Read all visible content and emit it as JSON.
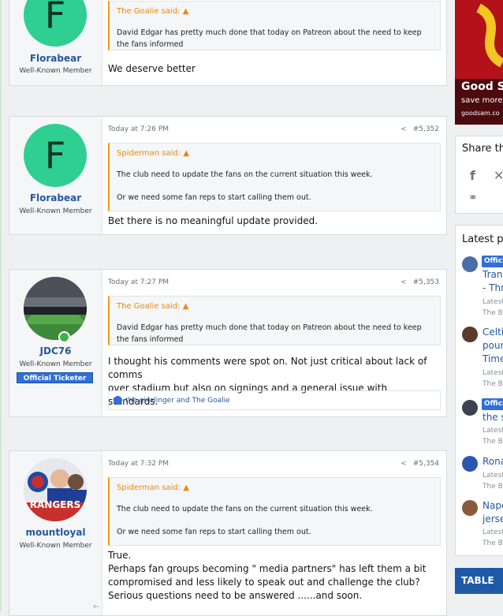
{
  "posts": [
    {
      "username": "Florabear",
      "user_title": "Well-Known Member",
      "avatar_letter": "F",
      "quote_author": "The Goalie said:",
      "quote_lines": [
        "David Edgar has pretty much done that today on Patreon about the need to keep",
        "the fans informed"
      ],
      "body_lines": [
        "We deserve better"
      ]
    },
    {
      "timestamp": "Today at 7:26 PM",
      "post_number": "#5,352",
      "username": "Florabear",
      "user_title": "Well-Known Member",
      "avatar_letter": "F",
      "quote_author": "Spiderman said:",
      "quote_lines": [
        "The club need to update the fans on the current situation this week.",
        "Or we need some fan reps to start calling them out."
      ],
      "body_lines": [
        "Bet there is no meaningful update provided."
      ]
    },
    {
      "timestamp": "Today at 7:27 PM",
      "post_number": "#5,353",
      "username": "JDC76",
      "user_title": "Well-Known Member",
      "user_badge": "Official Ticketer",
      "quote_author": "The Goalie said:",
      "quote_lines": [
        "David Edgar has pretty much done that today on Patreon about the need to keep",
        "the fans informed"
      ],
      "body_lines": [
        "I thought his comments were spot on. Not just critical about lack of comms",
        "over stadium but also on signings and a general issue with standards."
      ],
      "reactions": "the ginslinger and The Goalie"
    },
    {
      "timestamp": "Today at 7:32 PM",
      "post_number": "#5,354",
      "username": "mountloyal",
      "user_title": "Well-Known Member",
      "avatar_text": "RANGERS",
      "quote_author": "Spiderman said:",
      "quote_lines": [
        "The club need to update the fans on the current situation this week.",
        "Or we need some fan reps to start calling them out."
      ],
      "body_lines": [
        "True.",
        "Perhaps fan groups becoming \" media partners\" has left them a bit",
        "compromised and less likely to speak out and challenge the club?",
        "Serious questions need to be answered ......and soon."
      ]
    }
  ],
  "sidebar": {
    "ad": {
      "title": "Good S",
      "subtitle": "save more",
      "domain": "goodsam.co"
    },
    "share": {
      "title": "Share th"
    },
    "latest": {
      "title": "Latest po",
      "items": [
        {
          "tag": "Offici",
          "lines": [
            "Trans",
            "- Thr"
          ],
          "meta": [
            "Latest",
            "The B"
          ]
        },
        {
          "lines": [
            "Celtic",
            "pour",
            "Time"
          ],
          "meta": [
            "Latest",
            "The B"
          ]
        },
        {
          "tag": "Offici",
          "lines": [
            "the s"
          ],
          "meta": [
            "Latest",
            "The B"
          ]
        },
        {
          "lines": [
            "Rona"
          ],
          "meta": [
            "Latest",
            "The B"
          ]
        },
        {
          "lines": [
            "Napo",
            "jerse"
          ],
          "meta": [
            "Latest",
            "The B"
          ]
        }
      ]
    },
    "table_label": "TABLE"
  },
  "colors": {
    "accent": "#2557a0",
    "quote_bar": "#f29a1b",
    "avatar_green": "#2fcf92",
    "badge_blue": "#2f6fd7"
  }
}
